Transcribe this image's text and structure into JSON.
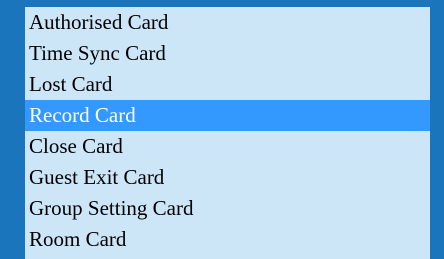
{
  "colors": {
    "background": "#1b75bc",
    "listbox_background": "#cce6f8",
    "selected_background": "#3399ff",
    "selected_text": "#ffffff",
    "text": "#000000"
  },
  "card_type_list": {
    "selected_index": 3,
    "options": [
      "Authorised Card",
      "Time Sync Card",
      "Lost Card",
      "Record Card",
      "Close Card",
      "Guest Exit Card",
      "Group Setting Card",
      "Room Card"
    ]
  }
}
